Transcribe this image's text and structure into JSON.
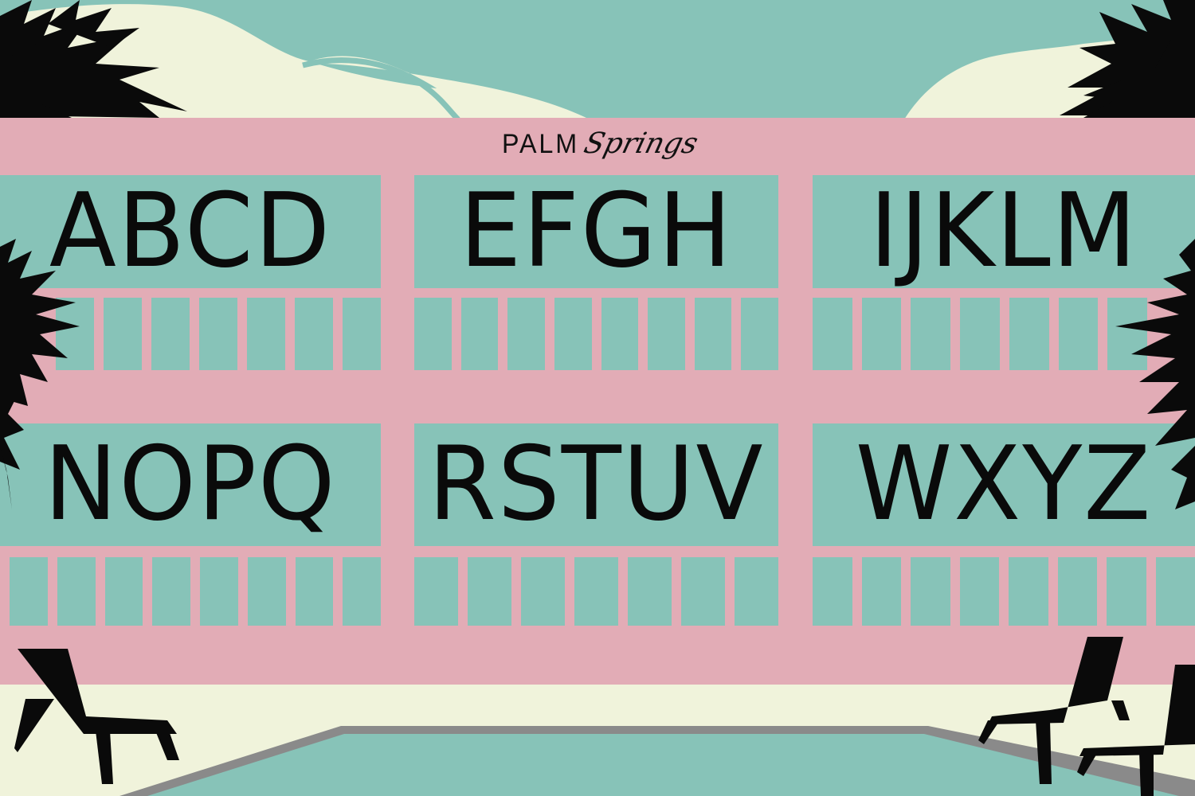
{
  "brand": {
    "main": "PALM",
    "script": "Springs"
  },
  "rows": [
    {
      "panels": [
        {
          "letters": "ABCD"
        },
        {
          "letters": "EFGH"
        },
        {
          "letters": "IJKLM"
        }
      ]
    },
    {
      "panels": [
        {
          "letters": "NOPQ"
        },
        {
          "letters": "RSTUV"
        },
        {
          "letters": "WXYZ"
        }
      ]
    }
  ],
  "colors": {
    "pink": "#e2acb6",
    "teal": "#87c3b8",
    "cream": "#f0f3db",
    "black": "#0a0a0a",
    "pool_edge": "#8a8a8a"
  },
  "icons": [
    "palm-tree-icon",
    "lounge-chair-icon",
    "mountain-icon",
    "pool-icon"
  ]
}
